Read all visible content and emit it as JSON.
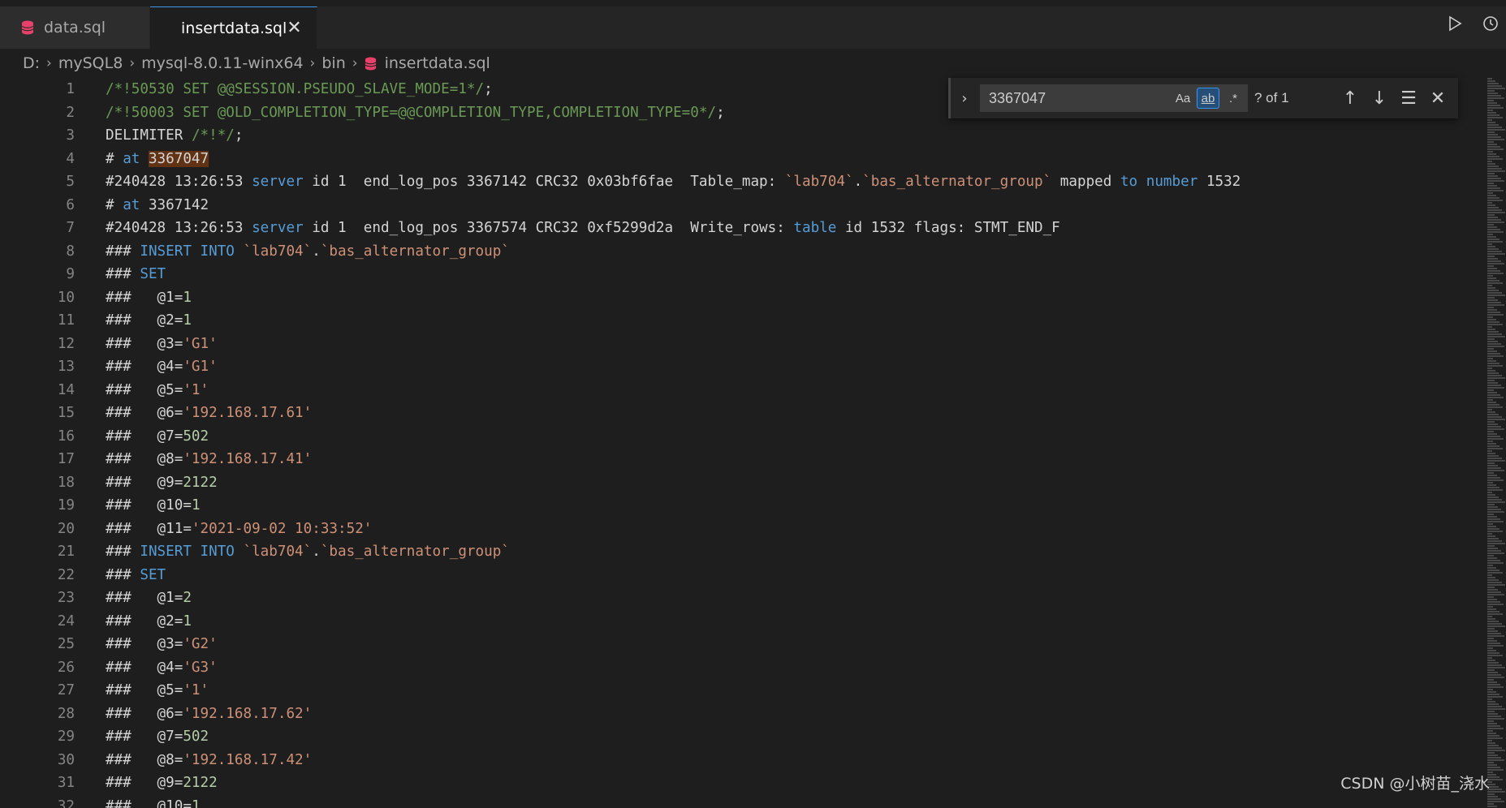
{
  "tabs": [
    {
      "label": "data.sql",
      "active": false
    },
    {
      "label": "insertdata.sql",
      "active": true
    }
  ],
  "tab_close_glyph": "✕",
  "breadcrumb": [
    "D:",
    "mySQL8",
    "mysql-8.0.11-winx64",
    "bin",
    "insertdata.sql"
  ],
  "find": {
    "query": "3367047",
    "match_case_label": "Aa",
    "whole_word_label": "ab",
    "regex_label": ".*",
    "count": "? of 1"
  },
  "editor_lines": [
    {
      "n": "1",
      "code": "/*!50530 SET @@SESSION.PSEUDO_SLAVE_MODE=1*/;"
    },
    {
      "n": "2",
      "code": "/*!50003 SET @OLD_COMPLETION_TYPE=@@COMPLETION_TYPE,COMPLETION_TYPE=0*/;"
    },
    {
      "n": "3",
      "code": "DELIMITER /*!*/;"
    },
    {
      "n": "4",
      "code": "# at 3367047"
    },
    {
      "n": "5",
      "code": "#240428 13:26:53 server id 1  end_log_pos 3367142 CRC32 0x03bf6fae  Table_map: `lab704`.`bas_alternator_group` mapped to number 1532"
    },
    {
      "n": "6",
      "code": "# at 3367142"
    },
    {
      "n": "7",
      "code": "#240428 13:26:53 server id 1  end_log_pos 3367574 CRC32 0xf5299d2a  Write_rows: table id 1532 flags: STMT_END_F"
    },
    {
      "n": "8",
      "code": "### INSERT INTO `lab704`.`bas_alternator_group`"
    },
    {
      "n": "9",
      "code": "### SET"
    },
    {
      "n": "10",
      "code": "###   @1=1"
    },
    {
      "n": "11",
      "code": "###   @2=1"
    },
    {
      "n": "12",
      "code": "###   @3='G1'"
    },
    {
      "n": "13",
      "code": "###   @4='G1'"
    },
    {
      "n": "14",
      "code": "###   @5='1'"
    },
    {
      "n": "15",
      "code": "###   @6='192.168.17.61'"
    },
    {
      "n": "16",
      "code": "###   @7=502"
    },
    {
      "n": "17",
      "code": "###   @8='192.168.17.41'"
    },
    {
      "n": "18",
      "code": "###   @9=2122"
    },
    {
      "n": "19",
      "code": "###   @10=1"
    },
    {
      "n": "20",
      "code": "###   @11='2021-09-02 10:33:52'"
    },
    {
      "n": "21",
      "code": "### INSERT INTO `lab704`.`bas_alternator_group`"
    },
    {
      "n": "22",
      "code": "### SET"
    },
    {
      "n": "23",
      "code": "###   @1=2"
    },
    {
      "n": "24",
      "code": "###   @2=1"
    },
    {
      "n": "25",
      "code": "###   @3='G2'"
    },
    {
      "n": "26",
      "code": "###   @4='G3'"
    },
    {
      "n": "27",
      "code": "###   @5='1'"
    },
    {
      "n": "28",
      "code": "###   @6='192.168.17.62'"
    },
    {
      "n": "29",
      "code": "###   @7=502"
    },
    {
      "n": "30",
      "code": "###   @8='192.168.17.42'"
    },
    {
      "n": "31",
      "code": "###   @9=2122"
    },
    {
      "n": "32",
      "code": "###   @10=1"
    }
  ],
  "watermark": "CSDN @小树苗_浇水",
  "colors": {
    "comment": "#6a9955",
    "keyword": "#569cd6",
    "string": "#ce9178",
    "number": "#b5cea8",
    "match_highlight": "#613214",
    "db_icon": "#e8406b"
  },
  "icons": [
    "database-icon",
    "close-icon",
    "run-icon",
    "history-icon",
    "chevron-right-icon",
    "arrow-up-icon",
    "arrow-down-icon",
    "find-in-selection-icon"
  ]
}
